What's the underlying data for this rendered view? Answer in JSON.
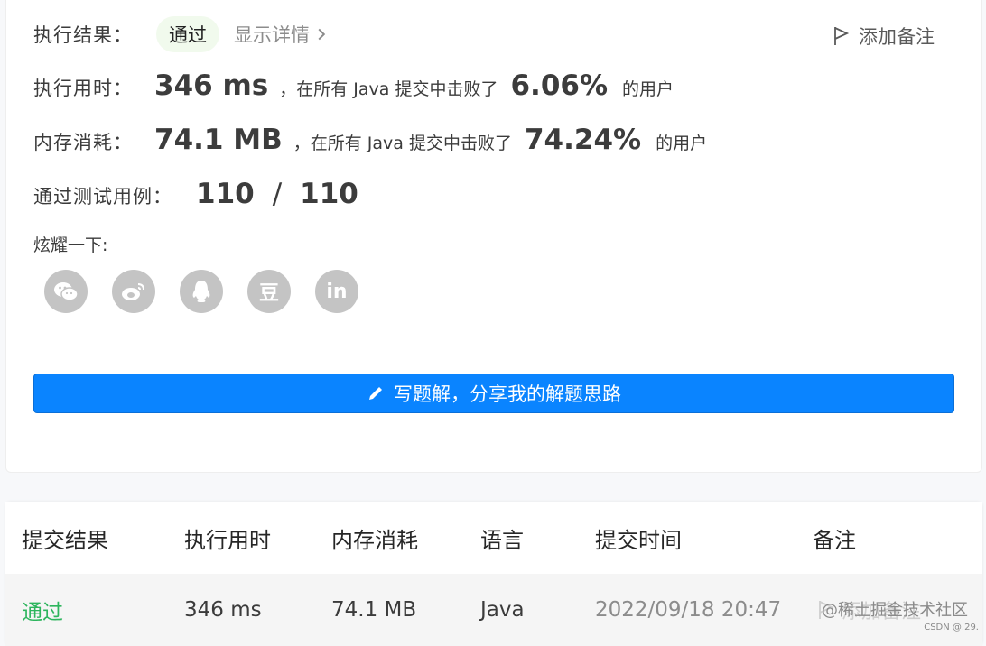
{
  "result": {
    "label": "执行结果：",
    "status": "通过",
    "details_link": "显示详情",
    "add_note": "添加备注"
  },
  "runtime": {
    "label": "执行用时：",
    "value": "346 ms",
    "compare_prefix": "，在所有 Java 提交中击败了",
    "percent": "6.06%",
    "suffix": "的用户"
  },
  "memory": {
    "label": "内存消耗：",
    "value": "74.1 MB",
    "compare_prefix": "，在所有 Java 提交中击败了",
    "percent": "74.24%",
    "suffix": "的用户"
  },
  "tests": {
    "label": "通过测试用例：",
    "passed": "110",
    "separator": "/",
    "total": "110"
  },
  "share": {
    "label": "炫耀一下:",
    "icons": [
      "wechat-icon",
      "weibo-icon",
      "qq-icon",
      "douban-icon",
      "linkedin-icon"
    ],
    "douban_glyph": "豆",
    "linkedin_glyph": "in"
  },
  "write_solution_button": "写题解，分享我的解题思路",
  "submissions": {
    "columns": [
      "提交结果",
      "执行用时",
      "内存消耗",
      "语言",
      "提交时间",
      "备注"
    ],
    "rows": [
      {
        "result": "通过",
        "runtime": "346 ms",
        "memory": "74.1 MB",
        "language": "Java",
        "time": "2022/09/18 20:47",
        "note": "添加备注"
      }
    ]
  },
  "watermark": "@稀土掘金技术社区",
  "watermark_small": "CSDN @.29.",
  "colors": {
    "primary_button": "#0a84ff",
    "pass_green": "#2db55d",
    "badge_bg": "#f1faed",
    "icon_gray": "#c4c4c4"
  }
}
